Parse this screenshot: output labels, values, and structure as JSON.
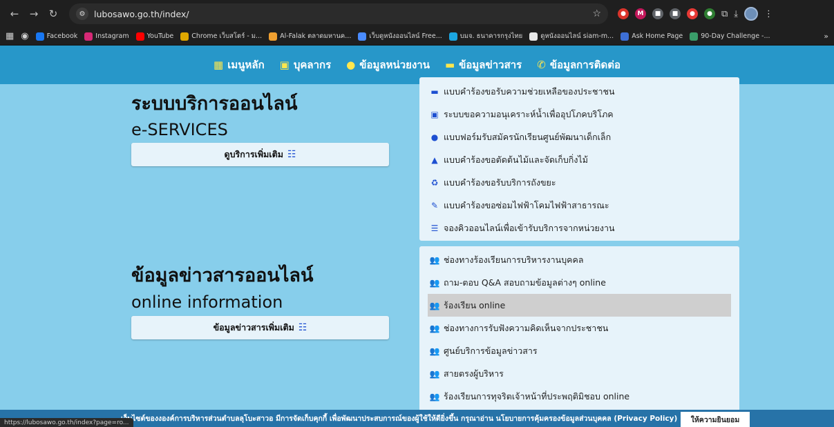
{
  "browser": {
    "url": "lubosawo.go.th/index/",
    "status_url": "https://lubosawo.go.th/index?page=ro...",
    "bookmarks": [
      {
        "label": "Facebook",
        "color": "#1877f2"
      },
      {
        "label": "Instagram",
        "color": "#d62976"
      },
      {
        "label": "YouTube",
        "color": "#ff0000"
      },
      {
        "label": "Chrome เว็บสโตร์ - ม...",
        "color": "#e0a800"
      },
      {
        "label": "Al-Falak ตลาดมหานค...",
        "color": "#f0a030"
      },
      {
        "label": "เว็บดูหนังออนไลน์ Free...",
        "color": "#4a8cff"
      },
      {
        "label": "บมจ. ธนาคารกรุงไทย",
        "color": "#1ba5e0"
      },
      {
        "label": "ดูหนังออนไลน์ siam-m...",
        "color": "#e8e8e8"
      },
      {
        "label": "Ask Home Page",
        "color": "#3d6fd6"
      },
      {
        "label": "90-Day Challenge -...",
        "color": "#3a9d6a"
      }
    ]
  },
  "nav": {
    "items": [
      {
        "label": "เมนูหลัก",
        "icon": "▦"
      },
      {
        "label": "บุคลากร",
        "icon": "▣"
      },
      {
        "label": "ข้อมูลหน่วยงาน",
        "icon": "●"
      },
      {
        "label": "ข้อมูลข่าวสาร",
        "icon": "▬"
      },
      {
        "label": "ข้อมูลการติดต่อ",
        "icon": "✆"
      }
    ]
  },
  "eservices": {
    "title": "ระบบบริการออนไลน์",
    "subtitle": "e-SERVICES",
    "more_label": "ดูบริการเพิ่มเติม",
    "items": [
      {
        "label": "แบบคำร้องขอรับความช่วยเหลือของประชาชน",
        "icon": "▬",
        "color": "#1d4fd1"
      },
      {
        "label": "ระบบขอความอนุเคราะห์น้ำเพื่ออุปโภคบริโภค",
        "icon": "▣",
        "color": "#1d4fd1"
      },
      {
        "label": "แบบฟอร์มรับสมัครนักเรียนศูนย์พัฒนาเด็กเล็ก",
        "icon": "●",
        "color": "#1d4fd1"
      },
      {
        "label": "แบบคำร้องขอตัดต้นไม้และจัดเก็บกิ่งไม้",
        "icon": "▲",
        "color": "#1d4fd1"
      },
      {
        "label": "แบบคำร้องขอรับบริการถังขยะ",
        "icon": "♻",
        "color": "#1d4fd1"
      },
      {
        "label": "แบบคำร้องขอซ่อมไฟฟ้าโคมไฟฟ้าสาธารณะ",
        "icon": "✎",
        "color": "#1d4fd1"
      },
      {
        "label": "จองคิวออนไลน์เพื่อเข้ารับบริการจากหน่วยงาน",
        "icon": "☰",
        "color": "#1d4fd1"
      }
    ]
  },
  "info": {
    "title": "ข้อมูลข่าวสารออนไลน์",
    "subtitle": "online information",
    "more_label": "ข้อมูลข่าวสารเพิ่มเติม",
    "items": [
      {
        "label": "ช่องทางร้องเรียนการบริหารงานบุคคล",
        "icon": "👥",
        "color": "#138a3d"
      },
      {
        "label": "ถาม-ตอบ Q&A สอบถามข้อมูลต่างๆ online",
        "icon": "👥",
        "color": "#138a3d"
      },
      {
        "label": "ร้องเรียน online",
        "icon": "👥",
        "color": "#138a3d"
      },
      {
        "label": "ช่องทางการรับฟังความคิดเห็นจากประชาชน",
        "icon": "👥",
        "color": "#138a3d"
      },
      {
        "label": "ศูนย์บริการข้อมูลข่าวสาร",
        "icon": "👥",
        "color": "#138a3d"
      },
      {
        "label": "สายตรงผู้บริหาร",
        "icon": "👥",
        "color": "#138a3d"
      },
      {
        "label": "ร้องเรียนการทุจริตเจ้าหน้าที่ประพฤติมิชอบ online",
        "icon": "👥",
        "color": "#138a3d"
      }
    ]
  },
  "cookie": {
    "text": "เว็บไซต์ของงองค์การบริหารส่วนตำบลลุโบะสาวอ มีการจัดเก็บคุกกี้ เพื่อพัฒนาประสบการณ์ของผู้ใช้ให้ดียิ่งขึ้น กรุณาอ่าน นโยบายการคุ้มครองข้อมูลส่วนบุคคล (Privacy Policy)",
    "accept_label": "ให้ความยินยอม"
  }
}
